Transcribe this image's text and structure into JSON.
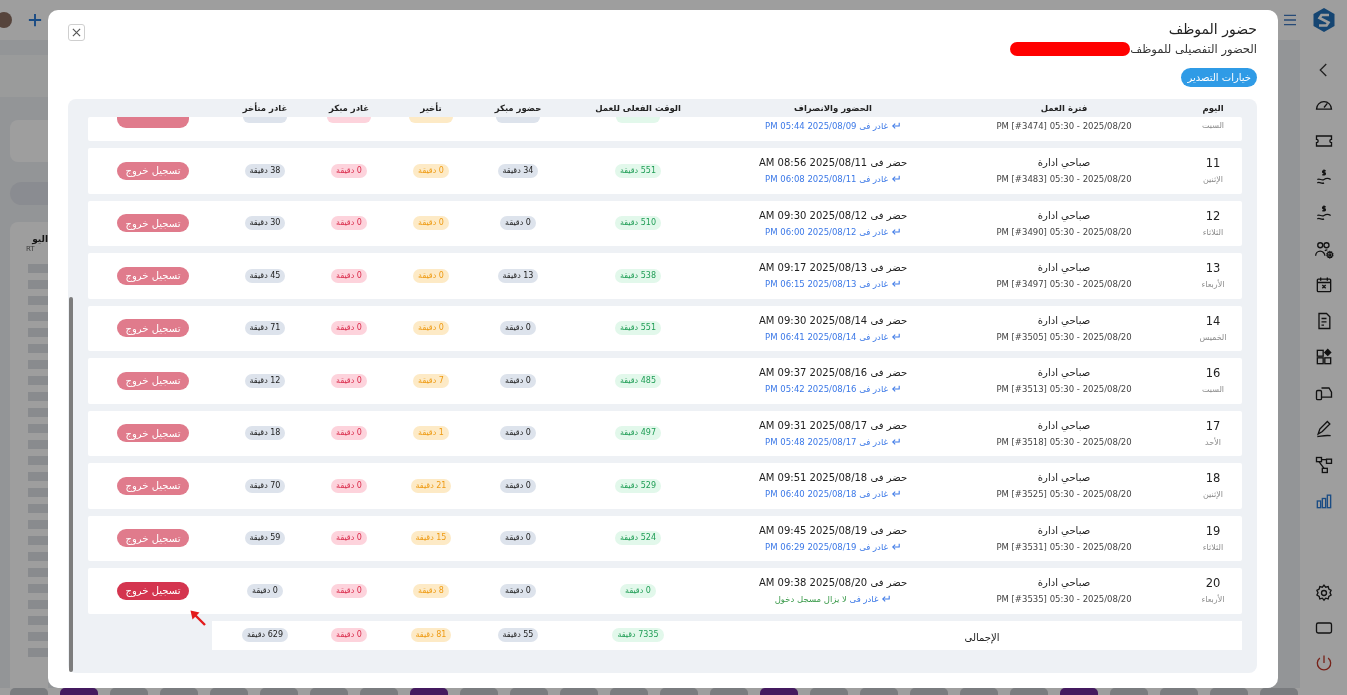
{
  "modal": {
    "title": "حضور الموظف",
    "subtitle": "الحضور التفصيلى للموظف",
    "name_redacted": true,
    "export_button": "خيارات التصدير"
  },
  "table": {
    "columns": [
      "اليوم",
      "فترة العمل",
      "الحضور والانصراف",
      "الوقت الفعلى للعمل",
      "حضور مبكر",
      "تأخير",
      "غادر مبكر",
      "غادر متأخر"
    ],
    "partial_row": {
      "day_name": "السبت",
      "shift": "2025/08/20 - 05:30 PM [#3474]",
      "check_out": {
        "label": "غادر فى",
        "value": "2025/08/09 05:44 PM",
        "kind": "time"
      }
    },
    "rows": [
      {
        "day": "11",
        "day_name": "الإثنين",
        "shift_name": "صباحي ادارة",
        "shift": "2025/08/20 - 05:30 PM [#3483]",
        "check_in": "حضر فى 2025/08/11 08:56 AM",
        "check_out": {
          "label": "غادر فى",
          "value": "2025/08/11 06:08 PM",
          "kind": "time"
        },
        "work_minutes": "551 دقيقة",
        "early_arrival": "34 دقيقة",
        "late": "0 دقيقة",
        "left_early": "0 دقيقة",
        "left_late": "38 دقيقة",
        "action": {
          "label": "تسجيل خروج",
          "disabled": true,
          "pointed_at": false
        }
      },
      {
        "day": "12",
        "day_name": "الثلاثاء",
        "shift_name": "صباحي ادارة",
        "shift": "2025/08/20 - 05:30 PM [#3490]",
        "check_in": "حضر فى 2025/08/12 09:30 AM",
        "check_out": {
          "label": "غادر فى",
          "value": "2025/08/12 06:00 PM",
          "kind": "time"
        },
        "work_minutes": "510 دقيقة",
        "early_arrival": "0 دقيقة",
        "late": "0 دقيقة",
        "left_early": "0 دقيقة",
        "left_late": "30 دقيقة",
        "action": {
          "label": "تسجيل خروج",
          "disabled": true,
          "pointed_at": false
        }
      },
      {
        "day": "13",
        "day_name": "الأربعاء",
        "shift_name": "صباحي ادارة",
        "shift": "2025/08/20 - 05:30 PM [#3497]",
        "check_in": "حضر فى 2025/08/13 09:17 AM",
        "check_out": {
          "label": "غادر فى",
          "value": "2025/08/13 06:15 PM",
          "kind": "time"
        },
        "work_minutes": "538 دقيقة",
        "early_arrival": "13 دقيقة",
        "late": "0 دقيقة",
        "left_early": "0 دقيقة",
        "left_late": "45 دقيقة",
        "action": {
          "label": "تسجيل خروج",
          "disabled": true,
          "pointed_at": false
        }
      },
      {
        "day": "14",
        "day_name": "الخميس",
        "shift_name": "صباحي ادارة",
        "shift": "2025/08/20 - 05:30 PM [#3505]",
        "check_in": "حضر فى 2025/08/14 09:30 AM",
        "check_out": {
          "label": "غادر فى",
          "value": "2025/08/14 06:41 PM",
          "kind": "time"
        },
        "work_minutes": "551 دقيقة",
        "early_arrival": "0 دقيقة",
        "late": "0 دقيقة",
        "left_early": "0 دقيقة",
        "left_late": "71 دقيقة",
        "action": {
          "label": "تسجيل خروج",
          "disabled": true,
          "pointed_at": false
        }
      },
      {
        "day": "16",
        "day_name": "السبت",
        "shift_name": "صباحي ادارة",
        "shift": "2025/08/20 - 05:30 PM [#3513]",
        "check_in": "حضر فى 2025/08/16 09:37 AM",
        "check_out": {
          "label": "غادر فى",
          "value": "2025/08/16 05:42 PM",
          "kind": "time"
        },
        "work_minutes": "485 دقيقة",
        "early_arrival": "0 دقيقة",
        "late": "7 دقيقة",
        "left_early": "0 دقيقة",
        "left_late": "12 دقيقة",
        "action": {
          "label": "تسجيل خروج",
          "disabled": true,
          "pointed_at": false
        }
      },
      {
        "day": "17",
        "day_name": "الأحد",
        "shift_name": "صباحي ادارة",
        "shift": "2025/08/20 - 05:30 PM [#3518]",
        "check_in": "حضر فى 2025/08/17 09:31 AM",
        "check_out": {
          "label": "غادر فى",
          "value": "2025/08/17 05:48 PM",
          "kind": "time"
        },
        "work_minutes": "497 دقيقة",
        "early_arrival": "0 دقيقة",
        "late": "1 دقيقة",
        "left_early": "0 دقيقة",
        "left_late": "18 دقيقة",
        "action": {
          "label": "تسجيل خروج",
          "disabled": true,
          "pointed_at": false
        }
      },
      {
        "day": "18",
        "day_name": "الإثنين",
        "shift_name": "صباحي ادارة",
        "shift": "2025/08/20 - 05:30 PM [#3525]",
        "check_in": "حضر فى 2025/08/18 09:51 AM",
        "check_out": {
          "label": "غادر فى",
          "value": "2025/08/18 06:40 PM",
          "kind": "time"
        },
        "work_minutes": "529 دقيقة",
        "early_arrival": "0 دقيقة",
        "late": "21 دقيقة",
        "left_early": "0 دقيقة",
        "left_late": "70 دقيقة",
        "action": {
          "label": "تسجيل خروج",
          "disabled": true,
          "pointed_at": false
        }
      },
      {
        "day": "19",
        "day_name": "الثلاثاء",
        "shift_name": "صباحي ادارة",
        "shift": "2025/08/20 - 05:30 PM [#3531]",
        "check_in": "حضر فى 2025/08/19 09:45 AM",
        "check_out": {
          "label": "غادر فى",
          "value": "2025/08/19 06:29 PM",
          "kind": "time"
        },
        "work_minutes": "524 دقيقة",
        "early_arrival": "0 دقيقة",
        "late": "15 دقيقة",
        "left_early": "0 دقيقة",
        "left_late": "59 دقيقة",
        "action": {
          "label": "تسجيل خروج",
          "disabled": true,
          "pointed_at": false
        }
      },
      {
        "day": "20",
        "day_name": "الأربعاء",
        "shift_name": "صباحي ادارة",
        "shift": "2025/08/20 - 05:30 PM [#3535]",
        "check_in": "حضر فى 2025/08/20 09:38 AM",
        "check_out": {
          "label": "غادر فى",
          "value": "لا يزال مسجل دخول",
          "kind": "still_in"
        },
        "work_minutes": "0 دقيقة",
        "early_arrival": "0 دقيقة",
        "late": "8 دقيقة",
        "left_early": "0 دقيقة",
        "left_late": "0 دقيقة",
        "action": {
          "label": "تسجيل خروج",
          "disabled": false,
          "pointed_at": true
        }
      }
    ],
    "total": {
      "label": "الإجمالى",
      "work_minutes": "7335 دقيقة",
      "early_arrival": "55 دقيقة",
      "late": "81 دقيقة",
      "left_early": "0 دقيقة",
      "left_late": "629 دقيقة"
    }
  },
  "sidebar": {
    "items": [
      {
        "selected": false
      },
      {
        "selected": false
      },
      {
        "selected": false
      },
      {
        "selected": false
      },
      {
        "selected": false
      },
      {
        "selected": false
      },
      {
        "selected": false
      },
      {
        "selected": false
      },
      {
        "selected": false
      },
      {
        "selected": false
      },
      {
        "selected": false
      },
      {
        "selected": true
      }
    ]
  },
  "background": {
    "column_heading": "اليو",
    "column_subheading": "RT"
  }
}
